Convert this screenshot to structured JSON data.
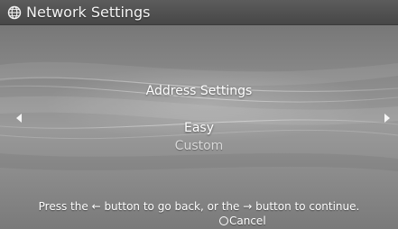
{
  "header": {
    "title": "Network Settings",
    "icon": "network-globe-icon"
  },
  "main": {
    "heading": "Address Settings",
    "options": [
      {
        "label": "Easy",
        "selected": true
      },
      {
        "label": "Custom",
        "selected": false
      }
    ],
    "nav_left_icon": "left-arrow-icon",
    "nav_right_icon": "right-arrow-icon"
  },
  "footer": {
    "instruction_part1": "Press the ",
    "back_arrow": "←",
    "instruction_part2": " button to go back, or the ",
    "forward_arrow": "→",
    "instruction_part3": " button to continue.",
    "cancel_label": "Cancel",
    "cancel_icon": "circle-button-icon"
  },
  "colors": {
    "background": "#8a8a8a",
    "title_bar": "#4f4f4f",
    "text": "#ffffff",
    "unselected_text": "#d9d9d9"
  }
}
